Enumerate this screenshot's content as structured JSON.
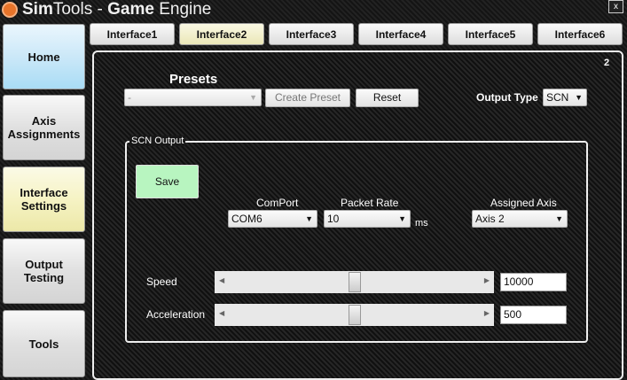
{
  "app": {
    "title_bold": "Sim",
    "title_rest": "Tools - ",
    "title_bold2": "Game",
    "title_end": " Engine",
    "close": "x"
  },
  "sidebar": [
    {
      "label": "Home"
    },
    {
      "label": "Axis Assignments"
    },
    {
      "label": "Interface Settings"
    },
    {
      "label": "Output Testing"
    },
    {
      "label": "Tools"
    }
  ],
  "tabs": [
    {
      "label": "Interface1"
    },
    {
      "label": "Interface2"
    },
    {
      "label": "Interface3"
    },
    {
      "label": "Interface4"
    },
    {
      "label": "Interface5"
    },
    {
      "label": "Interface6"
    }
  ],
  "panel": {
    "number": "2",
    "presets_label": "Presets",
    "preset_value": "-",
    "create_preset": "Create Preset",
    "reset": "Reset",
    "output_type_label": "Output Type",
    "output_type_value": "SCN"
  },
  "group": {
    "title": "SCN Output",
    "save": "Save",
    "comport_label": "ComPort",
    "comport_value": "COM6",
    "packet_rate_label": "Packet Rate",
    "packet_rate_value": "10",
    "ms": "ms",
    "axis_label": "Assigned Axis",
    "axis_value": "Axis 2",
    "speed_label": "Speed",
    "speed_value": "10000",
    "speed_slider_fraction": 0.5,
    "accel_label": "Acceleration",
    "accel_value": "500",
    "accel_slider_fraction": 0.5
  },
  "colors": {
    "home": "#cbe8f8",
    "interface_settings": "#f6f3c4",
    "active_tab": "#f0edc0",
    "save": "#b8f5c0"
  }
}
